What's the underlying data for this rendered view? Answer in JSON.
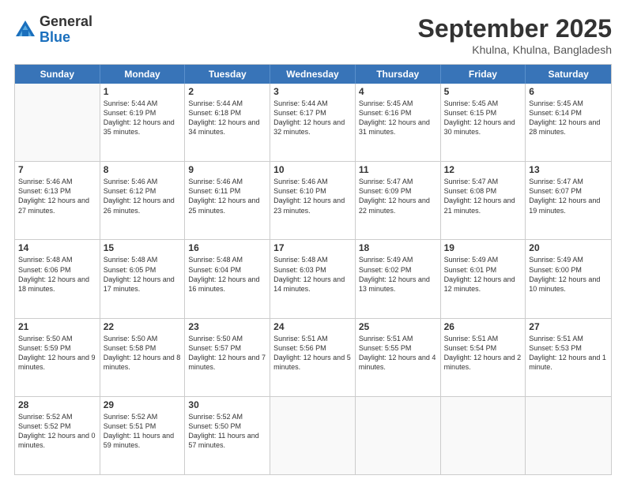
{
  "header": {
    "logo": {
      "general": "General",
      "blue": "Blue"
    },
    "title": "September 2025",
    "location": "Khulna, Khulna, Bangladesh"
  },
  "weekdays": [
    "Sunday",
    "Monday",
    "Tuesday",
    "Wednesday",
    "Thursday",
    "Friday",
    "Saturday"
  ],
  "rows": [
    [
      {
        "day": "",
        "sunrise": "",
        "sunset": "",
        "daylight": ""
      },
      {
        "day": "1",
        "sunrise": "Sunrise: 5:44 AM",
        "sunset": "Sunset: 6:19 PM",
        "daylight": "Daylight: 12 hours and 35 minutes."
      },
      {
        "day": "2",
        "sunrise": "Sunrise: 5:44 AM",
        "sunset": "Sunset: 6:18 PM",
        "daylight": "Daylight: 12 hours and 34 minutes."
      },
      {
        "day": "3",
        "sunrise": "Sunrise: 5:44 AM",
        "sunset": "Sunset: 6:17 PM",
        "daylight": "Daylight: 12 hours and 32 minutes."
      },
      {
        "day": "4",
        "sunrise": "Sunrise: 5:45 AM",
        "sunset": "Sunset: 6:16 PM",
        "daylight": "Daylight: 12 hours and 31 minutes."
      },
      {
        "day": "5",
        "sunrise": "Sunrise: 5:45 AM",
        "sunset": "Sunset: 6:15 PM",
        "daylight": "Daylight: 12 hours and 30 minutes."
      },
      {
        "day": "6",
        "sunrise": "Sunrise: 5:45 AM",
        "sunset": "Sunset: 6:14 PM",
        "daylight": "Daylight: 12 hours and 28 minutes."
      }
    ],
    [
      {
        "day": "7",
        "sunrise": "Sunrise: 5:46 AM",
        "sunset": "Sunset: 6:13 PM",
        "daylight": "Daylight: 12 hours and 27 minutes."
      },
      {
        "day": "8",
        "sunrise": "Sunrise: 5:46 AM",
        "sunset": "Sunset: 6:12 PM",
        "daylight": "Daylight: 12 hours and 26 minutes."
      },
      {
        "day": "9",
        "sunrise": "Sunrise: 5:46 AM",
        "sunset": "Sunset: 6:11 PM",
        "daylight": "Daylight: 12 hours and 25 minutes."
      },
      {
        "day": "10",
        "sunrise": "Sunrise: 5:46 AM",
        "sunset": "Sunset: 6:10 PM",
        "daylight": "Daylight: 12 hours and 23 minutes."
      },
      {
        "day": "11",
        "sunrise": "Sunrise: 5:47 AM",
        "sunset": "Sunset: 6:09 PM",
        "daylight": "Daylight: 12 hours and 22 minutes."
      },
      {
        "day": "12",
        "sunrise": "Sunrise: 5:47 AM",
        "sunset": "Sunset: 6:08 PM",
        "daylight": "Daylight: 12 hours and 21 minutes."
      },
      {
        "day": "13",
        "sunrise": "Sunrise: 5:47 AM",
        "sunset": "Sunset: 6:07 PM",
        "daylight": "Daylight: 12 hours and 19 minutes."
      }
    ],
    [
      {
        "day": "14",
        "sunrise": "Sunrise: 5:48 AM",
        "sunset": "Sunset: 6:06 PM",
        "daylight": "Daylight: 12 hours and 18 minutes."
      },
      {
        "day": "15",
        "sunrise": "Sunrise: 5:48 AM",
        "sunset": "Sunset: 6:05 PM",
        "daylight": "Daylight: 12 hours and 17 minutes."
      },
      {
        "day": "16",
        "sunrise": "Sunrise: 5:48 AM",
        "sunset": "Sunset: 6:04 PM",
        "daylight": "Daylight: 12 hours and 16 minutes."
      },
      {
        "day": "17",
        "sunrise": "Sunrise: 5:48 AM",
        "sunset": "Sunset: 6:03 PM",
        "daylight": "Daylight: 12 hours and 14 minutes."
      },
      {
        "day": "18",
        "sunrise": "Sunrise: 5:49 AM",
        "sunset": "Sunset: 6:02 PM",
        "daylight": "Daylight: 12 hours and 13 minutes."
      },
      {
        "day": "19",
        "sunrise": "Sunrise: 5:49 AM",
        "sunset": "Sunset: 6:01 PM",
        "daylight": "Daylight: 12 hours and 12 minutes."
      },
      {
        "day": "20",
        "sunrise": "Sunrise: 5:49 AM",
        "sunset": "Sunset: 6:00 PM",
        "daylight": "Daylight: 12 hours and 10 minutes."
      }
    ],
    [
      {
        "day": "21",
        "sunrise": "Sunrise: 5:50 AM",
        "sunset": "Sunset: 5:59 PM",
        "daylight": "Daylight: 12 hours and 9 minutes."
      },
      {
        "day": "22",
        "sunrise": "Sunrise: 5:50 AM",
        "sunset": "Sunset: 5:58 PM",
        "daylight": "Daylight: 12 hours and 8 minutes."
      },
      {
        "day": "23",
        "sunrise": "Sunrise: 5:50 AM",
        "sunset": "Sunset: 5:57 PM",
        "daylight": "Daylight: 12 hours and 7 minutes."
      },
      {
        "day": "24",
        "sunrise": "Sunrise: 5:51 AM",
        "sunset": "Sunset: 5:56 PM",
        "daylight": "Daylight: 12 hours and 5 minutes."
      },
      {
        "day": "25",
        "sunrise": "Sunrise: 5:51 AM",
        "sunset": "Sunset: 5:55 PM",
        "daylight": "Daylight: 12 hours and 4 minutes."
      },
      {
        "day": "26",
        "sunrise": "Sunrise: 5:51 AM",
        "sunset": "Sunset: 5:54 PM",
        "daylight": "Daylight: 12 hours and 2 minutes."
      },
      {
        "day": "27",
        "sunrise": "Sunrise: 5:51 AM",
        "sunset": "Sunset: 5:53 PM",
        "daylight": "Daylight: 12 hours and 1 minute."
      }
    ],
    [
      {
        "day": "28",
        "sunrise": "Sunrise: 5:52 AM",
        "sunset": "Sunset: 5:52 PM",
        "daylight": "Daylight: 12 hours and 0 minutes."
      },
      {
        "day": "29",
        "sunrise": "Sunrise: 5:52 AM",
        "sunset": "Sunset: 5:51 PM",
        "daylight": "Daylight: 11 hours and 59 minutes."
      },
      {
        "day": "30",
        "sunrise": "Sunrise: 5:52 AM",
        "sunset": "Sunset: 5:50 PM",
        "daylight": "Daylight: 11 hours and 57 minutes."
      },
      {
        "day": "",
        "sunrise": "",
        "sunset": "",
        "daylight": ""
      },
      {
        "day": "",
        "sunrise": "",
        "sunset": "",
        "daylight": ""
      },
      {
        "day": "",
        "sunrise": "",
        "sunset": "",
        "daylight": ""
      },
      {
        "day": "",
        "sunrise": "",
        "sunset": "",
        "daylight": ""
      }
    ]
  ]
}
